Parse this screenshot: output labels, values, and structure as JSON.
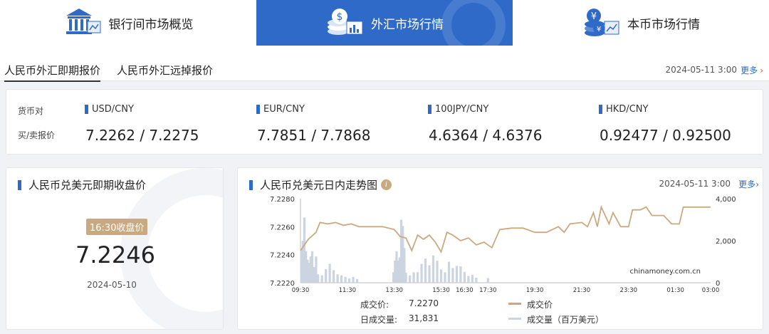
{
  "nav": [
    {
      "label": "银行间市场概览",
      "icon": "bank-building-icon",
      "active": false
    },
    {
      "label": "外汇市场行情",
      "icon": "fx-coins-chart-icon",
      "active": true
    },
    {
      "label": "本币市场行情",
      "icon": "rmb-coins-chart-icon",
      "active": false
    }
  ],
  "tabs": {
    "spot": "人民币外汇即期报价",
    "swap": "人民币外汇远掉报价",
    "date": "2024-05-11 3:00",
    "more": "更多"
  },
  "quotes": {
    "pair_label": "货币对",
    "price_label": "买/卖报价",
    "items": [
      {
        "pair": "USD/CNY",
        "price": "7.2262 / 7.2275"
      },
      {
        "pair": "EUR/CNY",
        "price": "7.7851 / 7.7868"
      },
      {
        "pair": "100JPY/CNY",
        "price": "4.6364 / 4.6376"
      },
      {
        "pair": "HKD/CNY",
        "price": "0.92477 / 0.92500"
      }
    ]
  },
  "close": {
    "title": "人民币兑美元即期收盘价",
    "badge": "16:30收盘价",
    "value": "7.2246",
    "date": "2024-05-10"
  },
  "intraday": {
    "title": "人民币兑美元日内走势图",
    "info_icon": "i",
    "date": "2024-05-11 3:00",
    "more": "更多",
    "watermark": "chinamoney.com.cn"
  },
  "footer": {
    "price_label": "成交价:",
    "price_value": "7.2270",
    "volume_label": "日成交量:",
    "volume_value": "31,831",
    "legend_price": "成交价",
    "legend_volume": "成交量（百万美元）"
  },
  "colors": {
    "accent": "#2f6ac8",
    "price_line": "#c9a97f",
    "volume_bar": "#ccd4e2",
    "more_chevron": "#e54545"
  },
  "chart_data": {
    "type": "line",
    "x_ticks": [
      "09:30",
      "11:30",
      "13:30",
      "15:30",
      "16:30",
      "17:30",
      "19:30",
      "21:30",
      "23:30",
      "01:30",
      "03:00"
    ],
    "y_left": {
      "ticks": [
        "7.2220",
        "7.2240",
        "7.2260",
        "7.2280"
      ],
      "range": [
        7.222,
        7.228
      ]
    },
    "y_right": {
      "ticks": [
        "0",
        "2,000",
        "4,000"
      ],
      "range": [
        0,
        4000
      ]
    },
    "series": [
      {
        "axis": "left",
        "points": [
          [
            "09:30",
            7.2243
          ],
          [
            "09:50",
            7.2251
          ],
          [
            "10:10",
            7.2256
          ],
          [
            "10:20",
            7.2263
          ],
          [
            "10:40",
            7.2262
          ],
          [
            "11:00",
            7.2263
          ],
          [
            "11:20",
            7.2261
          ],
          [
            "11:40",
            7.2262
          ],
          [
            "12:00",
            7.226
          ],
          [
            "12:30",
            7.226
          ],
          [
            "13:00",
            7.226
          ],
          [
            "13:30",
            7.2258
          ],
          [
            "13:45",
            7.2253
          ],
          [
            "14:00",
            7.2252
          ],
          [
            "14:15",
            7.2243
          ],
          [
            "14:30",
            7.2254
          ],
          [
            "14:45",
            7.2251
          ],
          [
            "15:00",
            7.2254
          ],
          [
            "15:15",
            7.2249
          ],
          [
            "15:30",
            7.2242
          ],
          [
            "15:45",
            7.2256
          ],
          [
            "16:00",
            7.2254
          ],
          [
            "16:20",
            7.225
          ],
          [
            "16:40",
            7.2252
          ],
          [
            "17:00",
            7.2247
          ],
          [
            "17:20",
            7.2249
          ],
          [
            "17:40",
            7.2245
          ],
          [
            "18:00",
            7.2258
          ],
          [
            "18:30",
            7.2259
          ],
          [
            "19:00",
            7.2259
          ],
          [
            "19:30",
            7.2256
          ],
          [
            "20:00",
            7.2256
          ],
          [
            "20:30",
            7.226
          ],
          [
            "20:45",
            7.2256
          ],
          [
            "21:00",
            7.2262
          ],
          [
            "21:30",
            7.2263
          ],
          [
            "21:45",
            7.226
          ],
          [
            "22:00",
            7.227
          ],
          [
            "22:10",
            7.226
          ],
          [
            "22:20",
            7.2274
          ],
          [
            "22:40",
            7.2262
          ],
          [
            "22:50",
            7.227
          ],
          [
            "23:10",
            7.226
          ],
          [
            "23:30",
            7.226
          ],
          [
            "23:40",
            7.2272
          ],
          [
            "00:00",
            7.2272
          ],
          [
            "00:15",
            7.2274
          ],
          [
            "00:30",
            7.2268
          ],
          [
            "01:00",
            7.2268
          ],
          [
            "01:20",
            7.2262
          ],
          [
            "01:40",
            7.2262
          ],
          [
            "01:50",
            7.2274
          ],
          [
            "03:00",
            7.2274
          ]
        ]
      },
      {
        "axis": "right",
        "type": "bar",
        "points": [
          [
            "09:32",
            1600
          ],
          [
            "09:36",
            2000
          ],
          [
            "09:40",
            3100
          ],
          [
            "09:44",
            1500
          ],
          [
            "09:48",
            1100
          ],
          [
            "09:52",
            950
          ],
          [
            "09:56",
            1250
          ],
          [
            "10:00",
            1500
          ],
          [
            "10:05",
            750
          ],
          [
            "10:10",
            1250
          ],
          [
            "10:15",
            400
          ],
          [
            "10:25",
            350
          ],
          [
            "10:35",
            650
          ],
          [
            "10:45",
            900
          ],
          [
            "10:55",
            600
          ],
          [
            "11:05",
            400
          ],
          [
            "11:15",
            350
          ],
          [
            "11:25",
            280
          ],
          [
            "11:35",
            200
          ],
          [
            "11:45",
            280
          ],
          [
            "11:55",
            180
          ],
          [
            "13:28",
            500
          ],
          [
            "13:32",
            1050
          ],
          [
            "13:36",
            1500
          ],
          [
            "13:40",
            1050
          ],
          [
            "13:44",
            1200
          ],
          [
            "13:48",
            3000
          ],
          [
            "13:52",
            2700
          ],
          [
            "13:56",
            1650
          ],
          [
            "14:00",
            480
          ],
          [
            "14:10",
            350
          ],
          [
            "14:20",
            500
          ],
          [
            "14:30",
            500
          ],
          [
            "14:40",
            900
          ],
          [
            "14:50",
            1150
          ],
          [
            "15:00",
            830
          ],
          [
            "15:10",
            1300
          ],
          [
            "15:20",
            1050
          ],
          [
            "15:30",
            630
          ],
          [
            "15:40",
            500
          ],
          [
            "15:50",
            1000
          ],
          [
            "16:00",
            700
          ],
          [
            "16:10",
            800
          ],
          [
            "16:20",
            780
          ],
          [
            "16:30",
            520
          ],
          [
            "16:40",
            320
          ],
          [
            "16:50",
            380
          ],
          [
            "17:00",
            240
          ],
          [
            "17:30",
            220
          ]
        ]
      }
    ]
  }
}
